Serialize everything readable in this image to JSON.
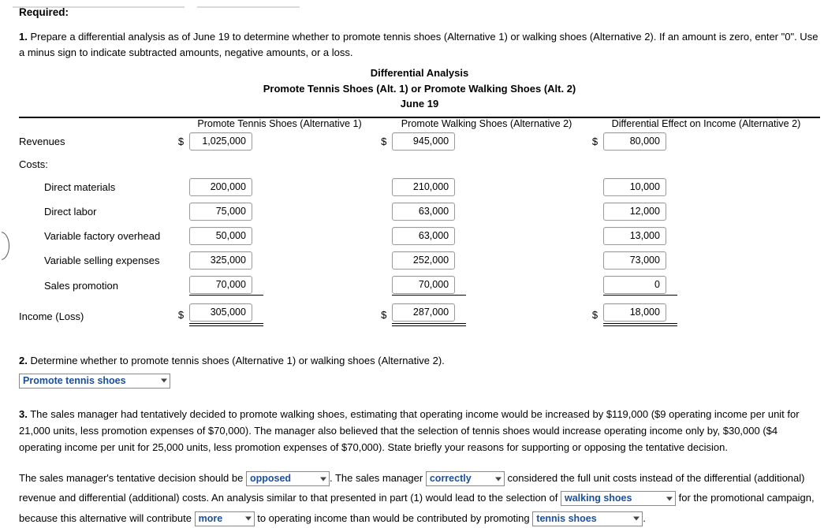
{
  "required_label": "Required:",
  "q1": {
    "num": "1.",
    "text": "Prepare a differential analysis as of June 19 to determine whether to promote tennis shoes (Alternative 1) or walking shoes (Alternative 2). If an amount is zero, enter \"0\". Use a minus sign to indicate subtracted amounts, negative amounts, or a loss."
  },
  "table": {
    "title_line1": "Differential Analysis",
    "title_line2": "Promote Tennis Shoes (Alt. 1) or Promote Walking Shoes (Alt. 2)",
    "title_line3": "June 19",
    "headers": [
      "",
      "Promote Tennis Shoes (Alternative 1)",
      "Promote Walking Shoes (Alternative 2)",
      "Differential Effect on Income (Alternative 2)"
    ],
    "rows": [
      {
        "label": "Revenues",
        "indent": false,
        "dollar": true,
        "values": [
          "1,025,000",
          "945,000",
          "80,000"
        ]
      },
      {
        "label": "Costs:",
        "indent": false,
        "dollar": false,
        "values": [
          null,
          null,
          null
        ]
      },
      {
        "label": "Direct materials",
        "indent": true,
        "dollar": false,
        "values": [
          "200,000",
          "210,000",
          "10,000"
        ]
      },
      {
        "label": "Direct labor",
        "indent": true,
        "dollar": false,
        "values": [
          "75,000",
          "63,000",
          "12,000"
        ]
      },
      {
        "label": "Variable factory overhead",
        "indent": true,
        "dollar": false,
        "values": [
          "50,000",
          "63,000",
          "13,000"
        ]
      },
      {
        "label": "Variable selling expenses",
        "indent": true,
        "dollar": false,
        "values": [
          "325,000",
          "252,000",
          "73,000"
        ]
      },
      {
        "label": "Sales promotion",
        "indent": true,
        "dollar": false,
        "values": [
          "70,000",
          "70,000",
          "0"
        ]
      },
      {
        "label": "Income (Loss)",
        "indent": false,
        "dollar": true,
        "total": true,
        "values": [
          "305,000",
          "287,000",
          "18,000"
        ]
      }
    ],
    "currency_symbol": "$"
  },
  "q2": {
    "num": "2.",
    "text": "Determine whether to promote tennis shoes (Alternative 1) or walking shoes (Alternative 2).",
    "answer": "Promote tennis shoes"
  },
  "q3": {
    "num": "3.",
    "text": "The sales manager had tentatively decided to promote walking shoes, estimating that operating income would be increased by $119,000 ($9 operating income per unit for 21,000 units, less promotion expenses of $70,000). The manager also believed that the selection of tennis shoes would increase operating income only by, $30,000 ($4 operating income per unit for 25,000 units, less promotion expenses of $70,000). State briefly your reasons for supporting or opposing the tentative decision.",
    "answer_part1": "The sales manager's tentative decision should be",
    "answer_sel1": "opposed",
    "answer_part2": ". The sales manager",
    "answer_sel2": "correctly",
    "answer_part3": "considered the full unit costs instead of the differential (additional) revenue and differential (additional) costs. An analysis similar to that presented in part (1) would lead to the selection of",
    "answer_sel3": "walking shoes",
    "answer_part4": "for the promotional campaign, because this alternative will contribute",
    "answer_sel4": "more",
    "answer_part5": "to operating income than would be contributed by promoting",
    "answer_sel5": "tennis shoes",
    "answer_part6": "."
  },
  "colors": {
    "select_text": "#1a4f9c",
    "rule": "#d9d9d9"
  }
}
